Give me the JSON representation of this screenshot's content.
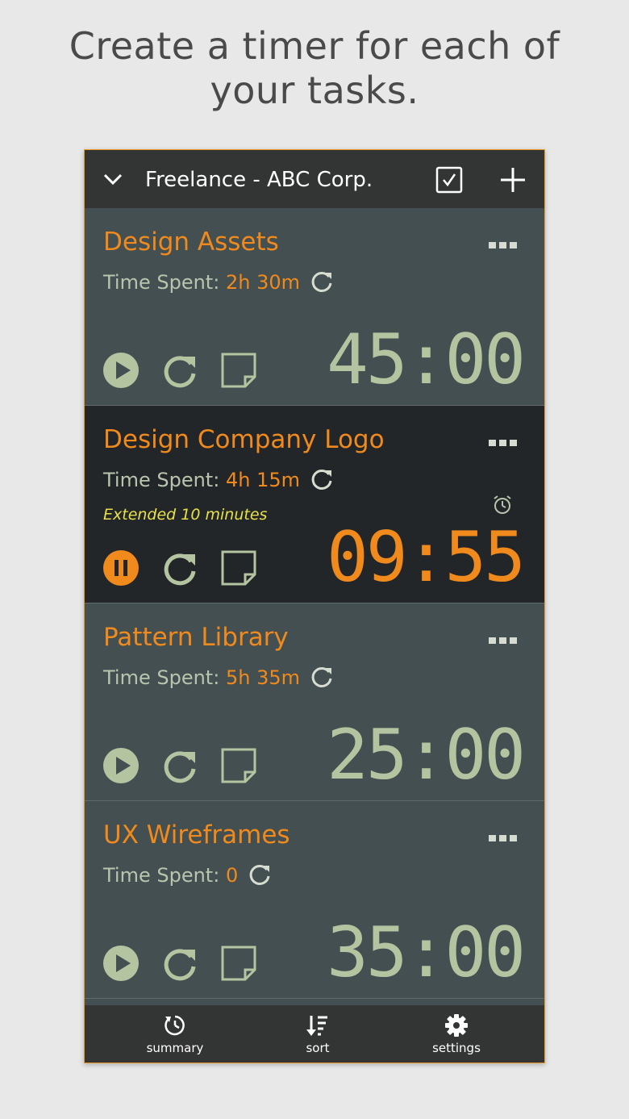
{
  "headline": {
    "line1": "Create a timer for each of",
    "line2": "your tasks."
  },
  "header": {
    "title": "Freelance - ABC Corp.",
    "icons": [
      "chevron-down-icon",
      "checkbox-icon",
      "plus-icon"
    ]
  },
  "tasks": [
    {
      "name": "Design Assets",
      "spent_label": "Time Spent:",
      "spent_value": "2h 30m",
      "timer": "45:00",
      "state": "paused",
      "extended": ""
    },
    {
      "name": "Design Company Logo",
      "spent_label": "Time Spent:",
      "spent_value": "4h 15m",
      "timer": "09:55",
      "state": "running",
      "extended": "Extended 10 minutes"
    },
    {
      "name": "Pattern Library",
      "spent_label": "Time Spent:",
      "spent_value": "5h 35m",
      "timer": "25:00",
      "state": "paused",
      "extended": ""
    },
    {
      "name": "UX Wireframes",
      "spent_label": "Time Spent:",
      "spent_value": "0",
      "timer": "35:00",
      "state": "paused",
      "extended": ""
    }
  ],
  "bottom_nav": [
    {
      "label": "summary",
      "icon": "clock-icon"
    },
    {
      "label": "sort",
      "icon": "sort-icon"
    },
    {
      "label": "settings",
      "icon": "gear-icon"
    }
  ],
  "colors": {
    "accent": "#f08a1c",
    "card": "#444f52",
    "active_card": "#232628",
    "timer": "#b4c4a0",
    "bar": "#333535"
  }
}
